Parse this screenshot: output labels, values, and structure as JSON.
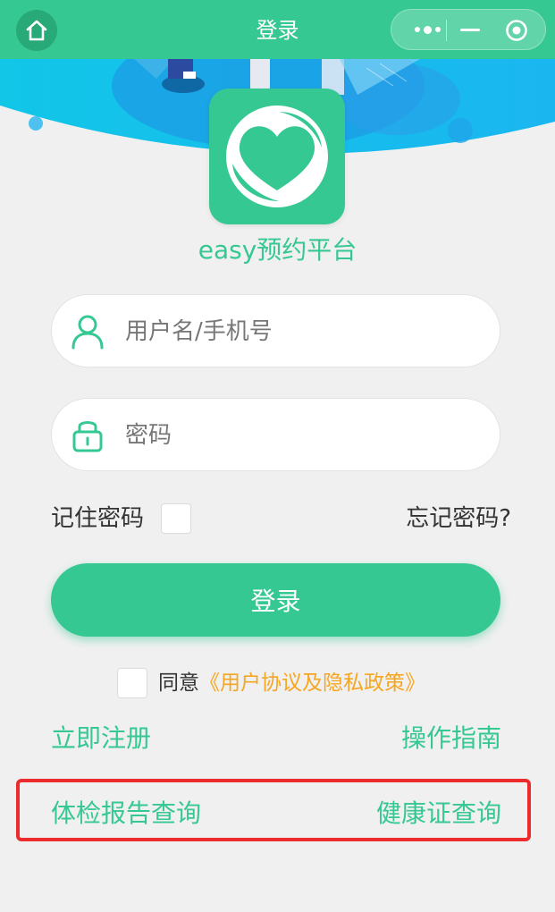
{
  "nav": {
    "title": "登录",
    "home_icon": "home-icon",
    "more_icon": "more-dots-icon",
    "minimize_icon": "minimize-icon",
    "close_icon": "target-close-icon",
    "bg_color": "#36c893"
  },
  "app": {
    "name": "easy预约平台",
    "logo_icon": "heart-logo-icon"
  },
  "form": {
    "username_placeholder": "用户名/手机号",
    "password_placeholder": "密码",
    "remember_label": "记住密码",
    "forgot_label": "忘记密码?",
    "login_label": "登录"
  },
  "agreement": {
    "prefix": "同意",
    "policy": "《用户协议及隐私政策》"
  },
  "links": {
    "register": "立即注册",
    "guide": "操作指南",
    "report": "体检报告查询",
    "health_cert": "健康证查询"
  },
  "colors": {
    "accent": "#36c893",
    "policy": "#f5a623",
    "highlight": "#ec2c2c"
  }
}
